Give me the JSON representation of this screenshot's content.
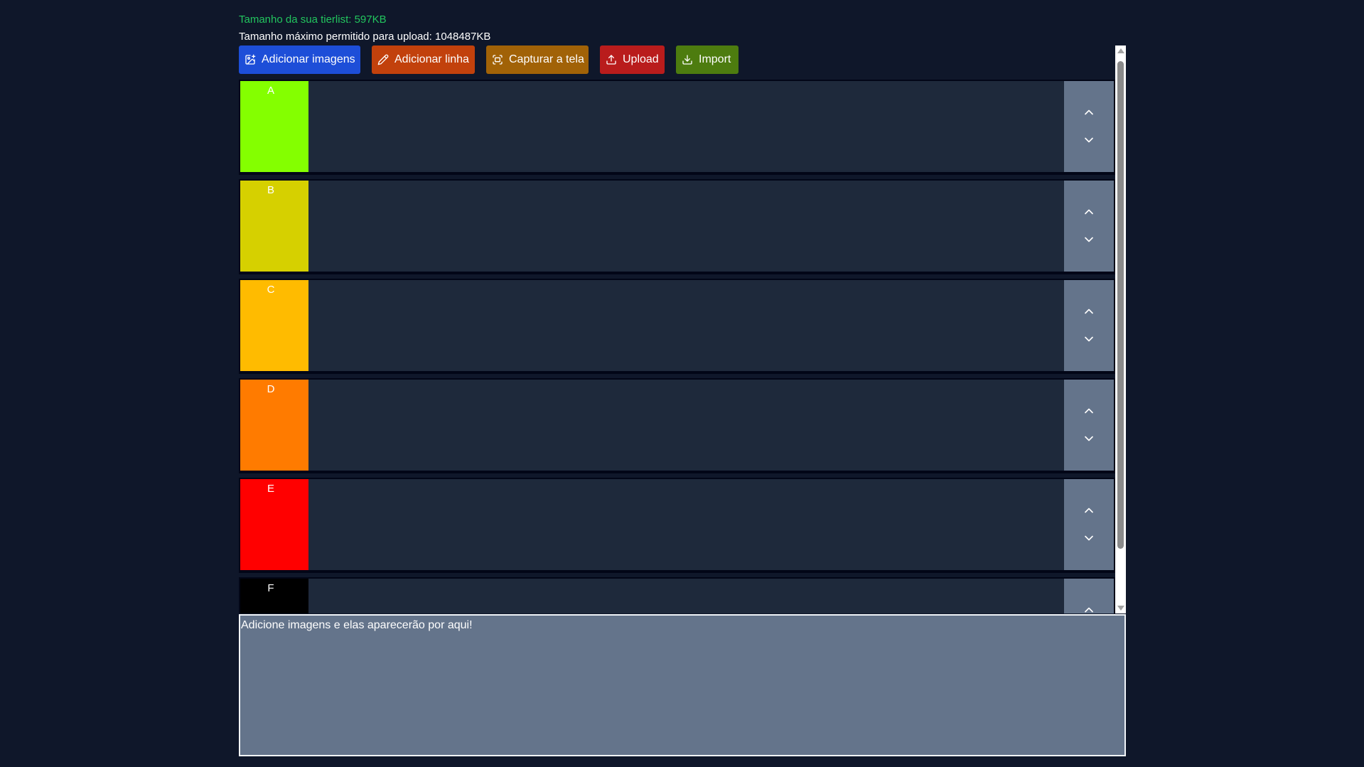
{
  "info": {
    "size_text": "Tamanho da sua tierlist: 597KB",
    "max_text": "Tamanho máximo permitido para upload: 1048487KB"
  },
  "toolbar": {
    "add_images": "Adicionar imagens",
    "add_row": "Adicionar linha",
    "capture": "Capturar a tela",
    "upload": "Upload",
    "import": "Import"
  },
  "tiers": [
    {
      "label": "A",
      "color": "#84ff00"
    },
    {
      "label": "B",
      "color": "#d6d000"
    },
    {
      "label": "C",
      "color": "#ffbb00"
    },
    {
      "label": "D",
      "color": "#ff7b00"
    },
    {
      "label": "E",
      "color": "#ff0000"
    },
    {
      "label": "F",
      "color": "#000000"
    }
  ],
  "images_area": {
    "placeholder": "Adicione imagens e elas aparecerão por aqui!"
  },
  "colors": {
    "background": "#0f172a",
    "row_background": "#1e293b",
    "control_background": "#64748b",
    "size_text": "#22c55e"
  },
  "icons": [
    "image-plus-icon",
    "pencil-icon",
    "screen-capture-icon",
    "upload-icon",
    "download-icon",
    "chevron-up-icon",
    "chevron-down-icon"
  ]
}
